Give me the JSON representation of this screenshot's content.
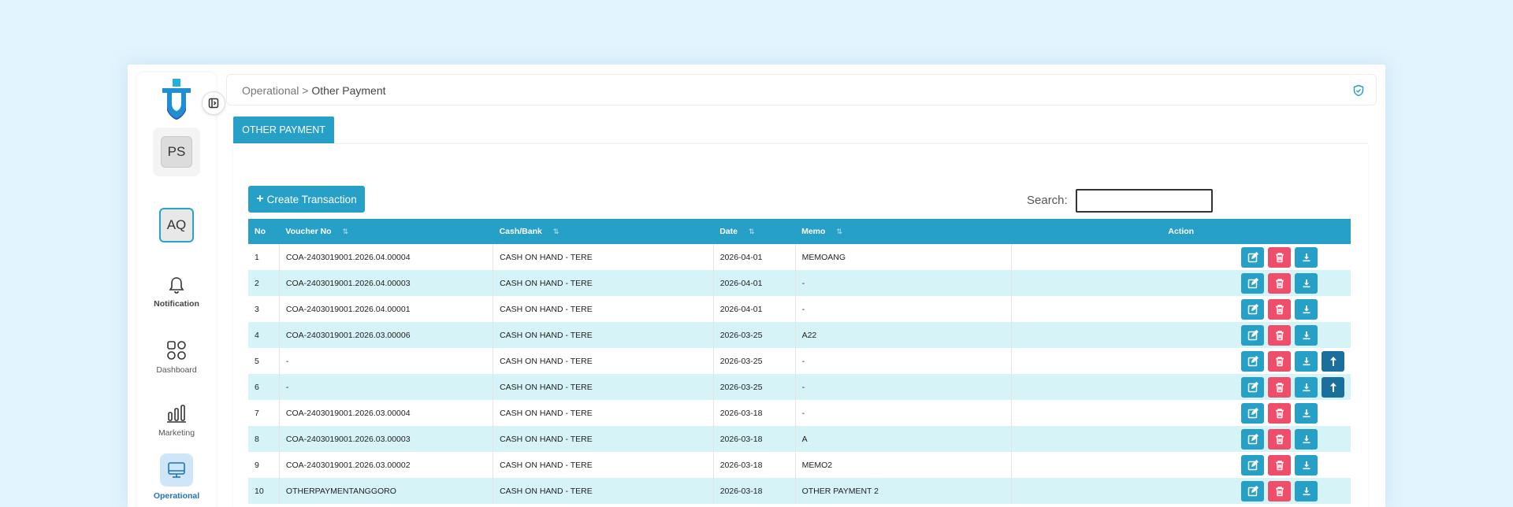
{
  "sidebar": {
    "profile_initials": "PS",
    "user_initials": "AQ",
    "items": [
      {
        "label": "Notification",
        "icon": "bell-icon"
      },
      {
        "label": "Dashboard",
        "icon": "grid-icon"
      },
      {
        "label": "Marketing",
        "icon": "bar-chart-icon"
      },
      {
        "label": "Operational",
        "icon": "monitor-icon",
        "active": true
      }
    ]
  },
  "breadcrumb": {
    "parent": "Operational",
    "separator": ">",
    "current": "Other Payment"
  },
  "tab": {
    "label": "OTHER PAYMENT"
  },
  "toolbar": {
    "create_label": "Create Transaction",
    "search_label": "Search:",
    "search_value": ""
  },
  "table": {
    "headers": [
      "No",
      "Voucher No",
      "Cash/Bank",
      "Date",
      "Memo",
      "Action"
    ],
    "rows": [
      {
        "no": "1",
        "voucher": "COA-2403019001.2026.04.00004",
        "cash": "CASH ON HAND - TERE",
        "date": "2026-04-01",
        "memo": "MEMOANG",
        "upload": false
      },
      {
        "no": "2",
        "voucher": "COA-2403019001.2026.04.00003",
        "cash": "CASH ON HAND - TERE",
        "date": "2026-04-01",
        "memo": "-",
        "upload": false
      },
      {
        "no": "3",
        "voucher": "COA-2403019001.2026.04.00001",
        "cash": "CASH ON HAND - TERE",
        "date": "2026-04-01",
        "memo": "-",
        "upload": false
      },
      {
        "no": "4",
        "voucher": "COA-2403019001.2026.03.00006",
        "cash": "CASH ON HAND - TERE",
        "date": "2026-03-25",
        "memo": "A22",
        "upload": false
      },
      {
        "no": "5",
        "voucher": "-",
        "cash": "CASH ON HAND - TERE",
        "date": "2026-03-25",
        "memo": "-",
        "upload": true
      },
      {
        "no": "6",
        "voucher": "-",
        "cash": "CASH ON HAND - TERE",
        "date": "2026-03-25",
        "memo": "-",
        "upload": true
      },
      {
        "no": "7",
        "voucher": "COA-2403019001.2026.03.00004",
        "cash": "CASH ON HAND - TERE",
        "date": "2026-03-18",
        "memo": "-",
        "upload": false
      },
      {
        "no": "8",
        "voucher": "COA-2403019001.2026.03.00003",
        "cash": "CASH ON HAND - TERE",
        "date": "2026-03-18",
        "memo": "A",
        "upload": false
      },
      {
        "no": "9",
        "voucher": "COA-2403019001.2026.03.00002",
        "cash": "CASH ON HAND - TERE",
        "date": "2026-03-18",
        "memo": "MEMO2",
        "upload": false
      },
      {
        "no": "10",
        "voucher": "OTHERPAYMENTANGGORO",
        "cash": "CASH ON HAND - TERE",
        "date": "2026-03-18",
        "memo": "OTHER PAYMENT 2",
        "upload": false
      }
    ]
  },
  "colors": {
    "accent": "#26a0c7",
    "danger": "#ef4e6b",
    "upload": "#1b6f9d",
    "row_alt": "#d6f3f8",
    "logo": "#1fa6d6"
  }
}
